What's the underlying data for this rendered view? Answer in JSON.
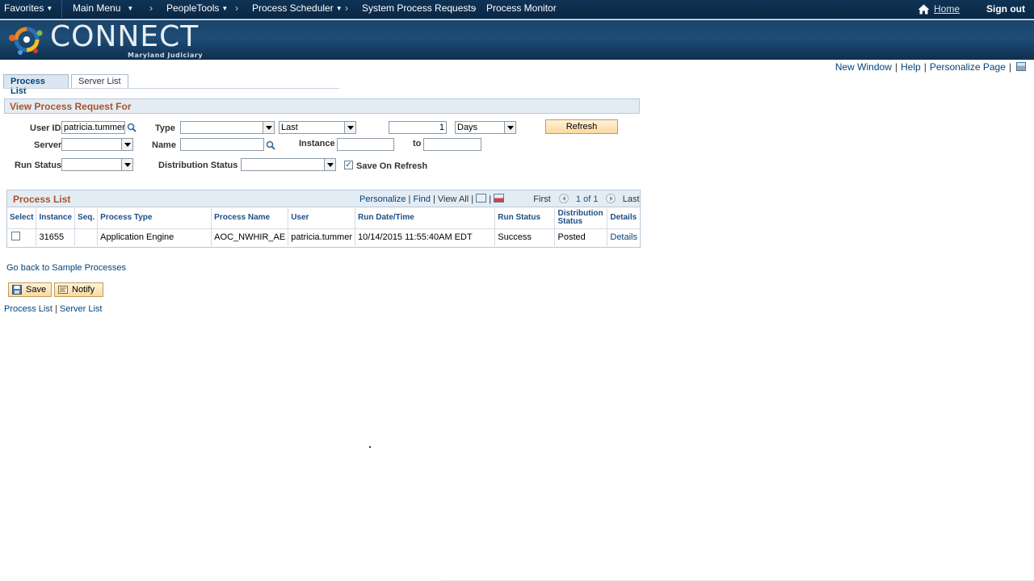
{
  "topnav": {
    "favorites": "Favorites",
    "main_menu": "Main Menu",
    "breadcrumbs": [
      "PeopleTools",
      "Process Scheduler",
      "System Process Requests",
      "Process Monitor"
    ],
    "home": "Home",
    "sign_out": "Sign out"
  },
  "banner": {
    "brand": "CONNECT",
    "subtitle": "Maryland Judiciary"
  },
  "page_links": {
    "new_window": "New Window",
    "help": "Help",
    "personalize_page": "Personalize Page"
  },
  "tabs": [
    {
      "label": "Process List",
      "active": true
    },
    {
      "label": "Server List",
      "active": false
    }
  ],
  "criteria": {
    "header": "View Process Request For",
    "user_id_label": "User ID",
    "user_id_value": "patricia.tummer",
    "type_label": "Type",
    "type_value": "",
    "range_value": "Last",
    "count_value": "1",
    "unit_value": "Days",
    "refresh_label": "Refresh",
    "server_label": "Server",
    "server_value": "",
    "name_label": "Name",
    "name_value": "",
    "instance_label": "Instance",
    "instance_from": "",
    "to_label": "to",
    "instance_to": "",
    "run_status_label": "Run Status",
    "run_status_value": "",
    "dist_status_label": "Distribution Status",
    "dist_status_value": "",
    "save_on_refresh_label": "Save On Refresh",
    "save_on_refresh_checked": true
  },
  "grid": {
    "title": "Process List",
    "personalize": "Personalize",
    "find": "Find",
    "view_all": "View All",
    "first": "First",
    "page_info": "1 of 1",
    "last": "Last",
    "columns": [
      "Select",
      "Instance",
      "Seq.",
      "Process Type",
      "Process Name",
      "User",
      "Run Date/Time",
      "Run Status",
      "Distribution Status",
      "Details"
    ],
    "rows": [
      {
        "instance": "31655",
        "seq": "",
        "process_type": "Application Engine",
        "process_name": "AOC_NWHIR_AE",
        "user": "patricia.tummer",
        "run_datetime": "10/14/2015 11:55:40AM EDT",
        "run_status": "Success",
        "dist_status": "Posted",
        "details": "Details"
      }
    ]
  },
  "footer": {
    "back_link": "Go back to Sample Processes",
    "save": "Save",
    "notify": "Notify",
    "process_list": "Process List",
    "server_list": "Server List"
  },
  "colors": {
    "nav_bg": "#0f3355",
    "section_title": "#a8532c",
    "link": "#00447c",
    "button_bg": "#fbd9a0"
  }
}
